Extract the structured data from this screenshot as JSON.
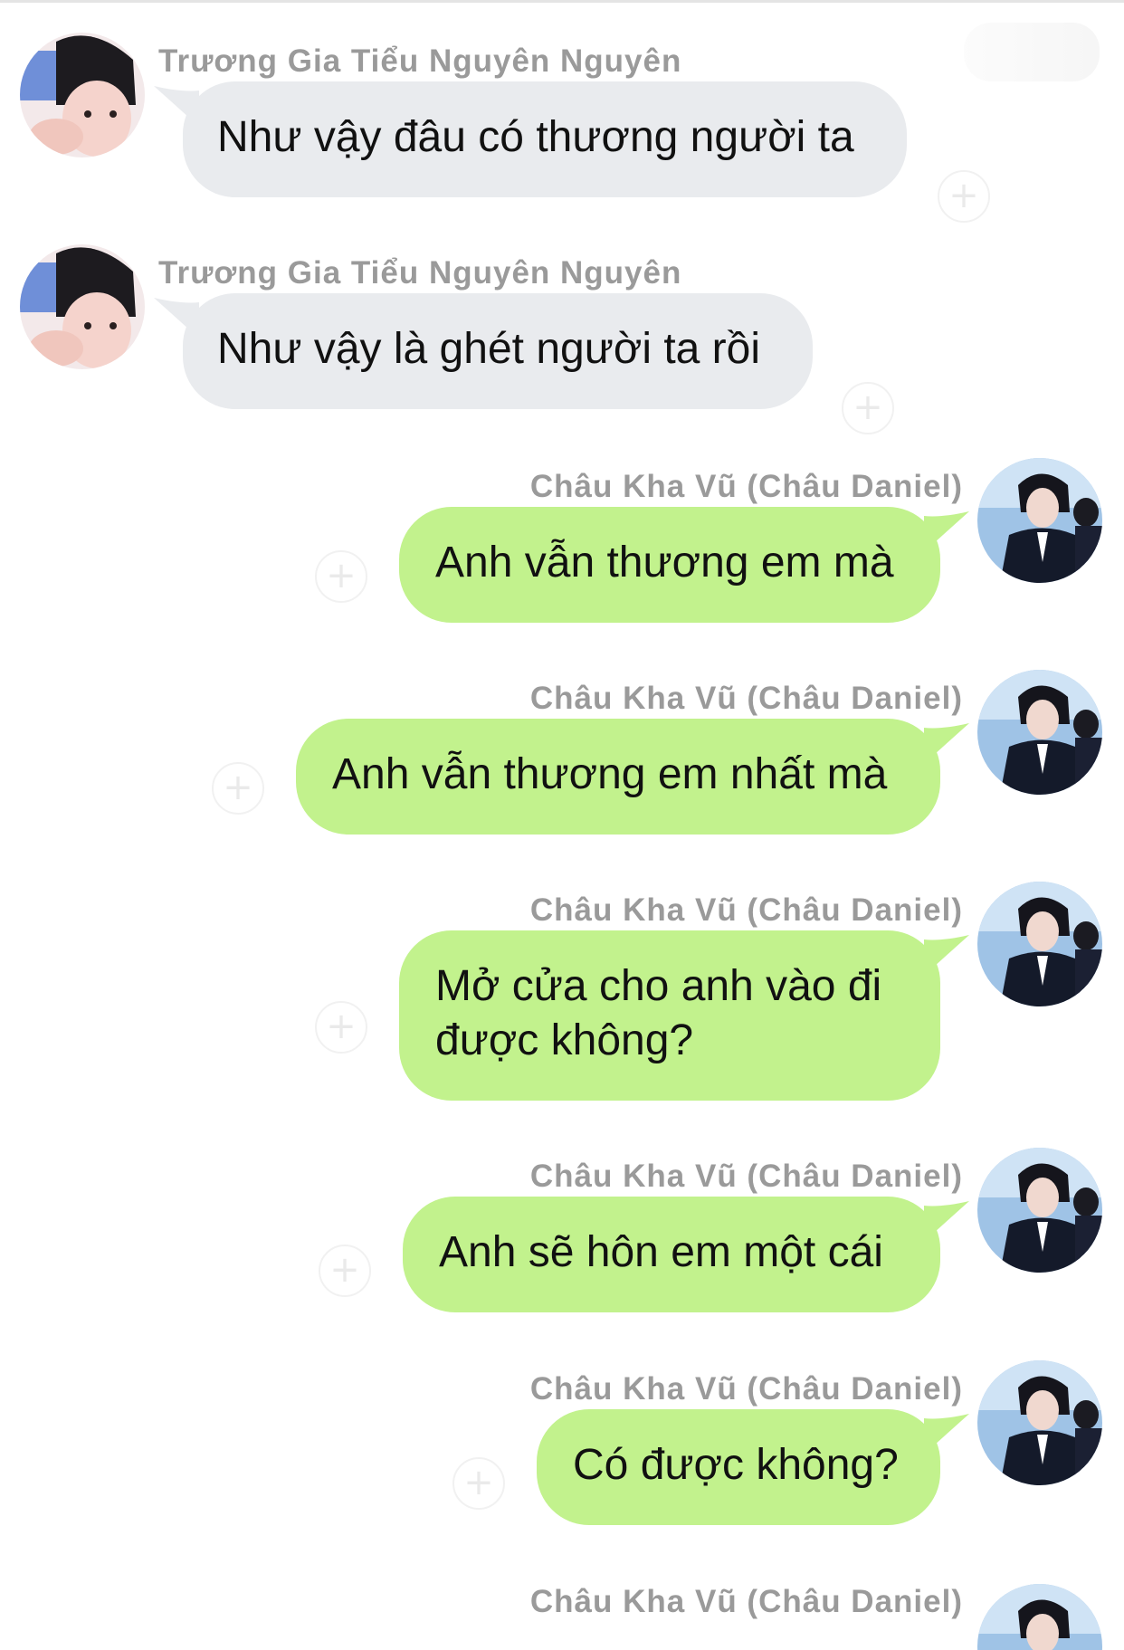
{
  "chat": {
    "participants": {
      "other": "Trương Gia Tiểu Nguyên Nguyên",
      "me": "Châu Kha Vũ (Châu Daniel)"
    },
    "react_icon": "+",
    "messages": [
      {
        "sender": "Trương Gia Tiểu Nguyên Nguyên",
        "text": "Như vậy đâu có thương người ta"
      },
      {
        "sender": "Trương Gia Tiểu Nguyên Nguyên",
        "text": "Như vậy là ghét người ta rồi"
      },
      {
        "sender": "Châu Kha Vũ (Châu Daniel)",
        "text": "Anh vẫn thương em mà"
      },
      {
        "sender": "Châu Kha Vũ (Châu Daniel)",
        "text": "Anh vẫn thương em nhất mà"
      },
      {
        "sender": "Châu Kha Vũ (Châu Daniel)",
        "text": "Mở cửa cho anh vào đi được không?"
      },
      {
        "sender": "Châu Kha Vũ (Châu Daniel)",
        "text": "Anh sẽ hôn em một cái"
      },
      {
        "sender": "Châu Kha Vũ (Châu Daniel)",
        "text": "Có được không?"
      },
      {
        "sender": "Châu Kha Vũ (Châu Daniel)",
        "text": ""
      }
    ]
  },
  "colors": {
    "incoming_bubble": "#e9ebee",
    "outgoing_bubble": "#c2f28d",
    "sender_name": "#9a9a9a"
  }
}
